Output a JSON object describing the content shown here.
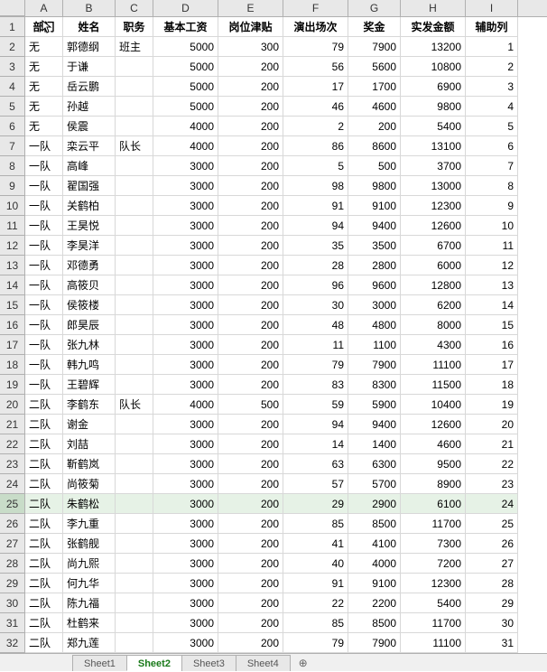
{
  "columns": [
    "A",
    "B",
    "C",
    "D",
    "E",
    "F",
    "G",
    "H",
    "I"
  ],
  "col_widths": [
    "wA",
    "wB",
    "wC",
    "wD",
    "wE",
    "wF",
    "wG",
    "wH",
    "wI"
  ],
  "header": [
    "部门",
    "姓名",
    "职务",
    "基本工资",
    "岗位津贴",
    "演出场次",
    "奖金",
    "实发金额",
    "辅助列"
  ],
  "rows": [
    [
      "无",
      "郭德纲",
      "班主",
      "5000",
      "300",
      "79",
      "7900",
      "13200",
      "1"
    ],
    [
      "无",
      "于谦",
      "",
      "5000",
      "200",
      "56",
      "5600",
      "10800",
      "2"
    ],
    [
      "无",
      "岳云鹏",
      "",
      "5000",
      "200",
      "17",
      "1700",
      "6900",
      "3"
    ],
    [
      "无",
      "孙越",
      "",
      "5000",
      "200",
      "46",
      "4600",
      "9800",
      "4"
    ],
    [
      "无",
      "侯震",
      "",
      "4000",
      "200",
      "2",
      "200",
      "5400",
      "5"
    ],
    [
      "一队",
      "栾云平",
      "队长",
      "4000",
      "200",
      "86",
      "8600",
      "13100",
      "6"
    ],
    [
      "一队",
      "高峰",
      "",
      "3000",
      "200",
      "5",
      "500",
      "3700",
      "7"
    ],
    [
      "一队",
      "翟国强",
      "",
      "3000",
      "200",
      "98",
      "9800",
      "13000",
      "8"
    ],
    [
      "一队",
      "关鹤柏",
      "",
      "3000",
      "200",
      "91",
      "9100",
      "12300",
      "9"
    ],
    [
      "一队",
      "王昊悦",
      "",
      "3000",
      "200",
      "94",
      "9400",
      "12600",
      "10"
    ],
    [
      "一队",
      "李昊洋",
      "",
      "3000",
      "200",
      "35",
      "3500",
      "6700",
      "11"
    ],
    [
      "一队",
      "邓德勇",
      "",
      "3000",
      "200",
      "28",
      "2800",
      "6000",
      "12"
    ],
    [
      "一队",
      "高筱贝",
      "",
      "3000",
      "200",
      "96",
      "9600",
      "12800",
      "13"
    ],
    [
      "一队",
      "侯筱楼",
      "",
      "3000",
      "200",
      "30",
      "3000",
      "6200",
      "14"
    ],
    [
      "一队",
      "郎昊辰",
      "",
      "3000",
      "200",
      "48",
      "4800",
      "8000",
      "15"
    ],
    [
      "一队",
      "张九林",
      "",
      "3000",
      "200",
      "11",
      "1100",
      "4300",
      "16"
    ],
    [
      "一队",
      "韩九鸣",
      "",
      "3000",
      "200",
      "79",
      "7900",
      "11100",
      "17"
    ],
    [
      "一队",
      "王碧辉",
      "",
      "3000",
      "200",
      "83",
      "8300",
      "11500",
      "18"
    ],
    [
      "二队",
      "李鹤东",
      "队长",
      "4000",
      "500",
      "59",
      "5900",
      "10400",
      "19"
    ],
    [
      "二队",
      "谢金",
      "",
      "3000",
      "200",
      "94",
      "9400",
      "12600",
      "20"
    ],
    [
      "二队",
      "刘喆",
      "",
      "3000",
      "200",
      "14",
      "1400",
      "4600",
      "21"
    ],
    [
      "二队",
      "靳鹤岚",
      "",
      "3000",
      "200",
      "63",
      "6300",
      "9500",
      "22"
    ],
    [
      "二队",
      "尚筱菊",
      "",
      "3000",
      "200",
      "57",
      "5700",
      "8900",
      "23"
    ],
    [
      "二队",
      "朱鹤松",
      "",
      "3000",
      "200",
      "29",
      "2900",
      "6100",
      "24"
    ],
    [
      "二队",
      "李九重",
      "",
      "3000",
      "200",
      "85",
      "8500",
      "11700",
      "25"
    ],
    [
      "二队",
      "张鹤舰",
      "",
      "3000",
      "200",
      "41",
      "4100",
      "7300",
      "26"
    ],
    [
      "二队",
      "尚九熙",
      "",
      "3000",
      "200",
      "40",
      "4000",
      "7200",
      "27"
    ],
    [
      "二队",
      "何九华",
      "",
      "3000",
      "200",
      "91",
      "9100",
      "12300",
      "28"
    ],
    [
      "二队",
      "陈九福",
      "",
      "3000",
      "200",
      "22",
      "2200",
      "5400",
      "29"
    ],
    [
      "二队",
      "杜鹤来",
      "",
      "3000",
      "200",
      "85",
      "8500",
      "11700",
      "30"
    ],
    [
      "二队",
      "郑九莲",
      "",
      "3000",
      "200",
      "79",
      "7900",
      "11100",
      "31"
    ]
  ],
  "numeric_cols": [
    3,
    4,
    5,
    6,
    7,
    8
  ],
  "selected_row_index": 23,
  "sheet_tabs": [
    "Sheet1",
    "Sheet2",
    "Sheet3",
    "Sheet4"
  ],
  "active_tab": 1,
  "add_sheet_glyph": "⊕",
  "chart_data": {
    "type": "table",
    "columns": [
      "部门",
      "姓名",
      "职务",
      "基本工资",
      "岗位津贴",
      "演出场次",
      "奖金",
      "实发金额",
      "辅助列"
    ]
  }
}
